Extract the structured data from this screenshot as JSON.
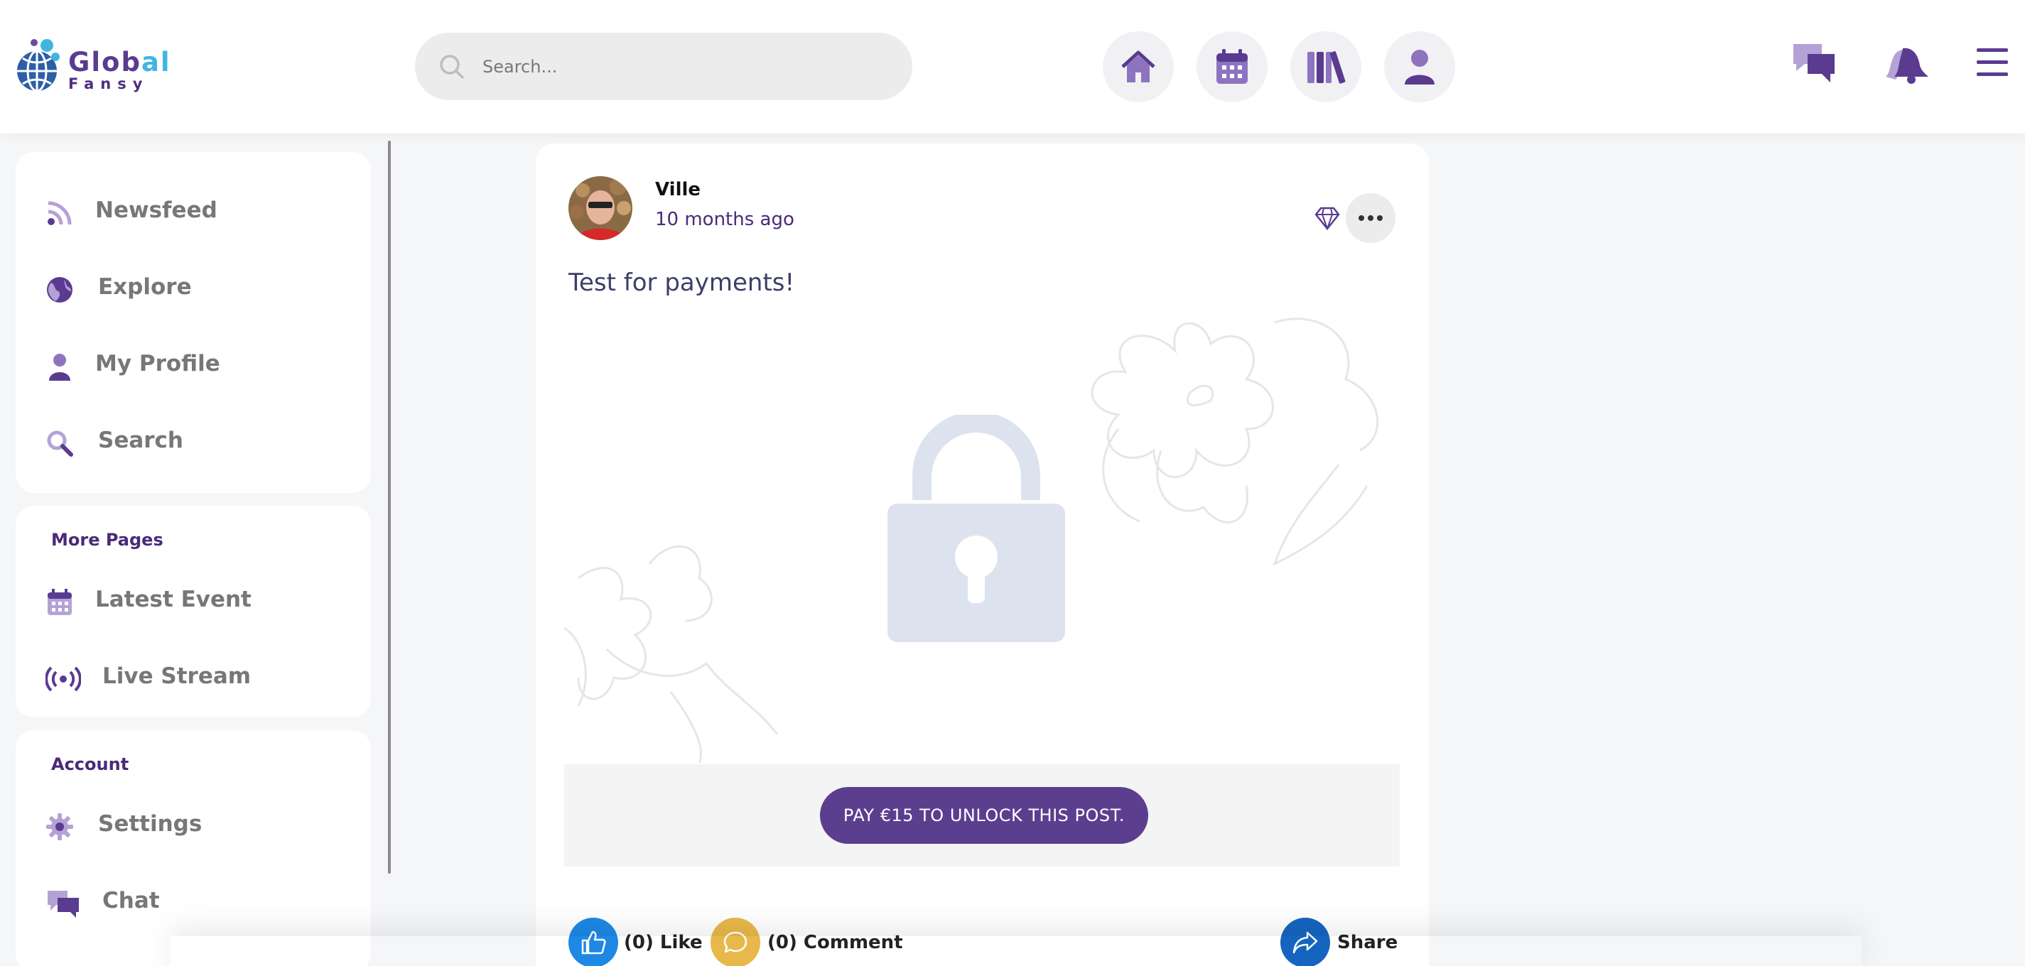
{
  "brand": {
    "line1_a": "Glob",
    "line1_b": "al",
    "line2": "Fansy"
  },
  "search": {
    "placeholder": "Search..."
  },
  "sidebar": {
    "main_items": [
      {
        "label": "Newsfeed",
        "icon": "rss-icon"
      },
      {
        "label": "Explore",
        "icon": "globe-icon"
      },
      {
        "label": "My Profile",
        "icon": "user-icon"
      },
      {
        "label": "Search",
        "icon": "search-icon"
      }
    ],
    "more_pages_title": "More Pages",
    "more_items": [
      {
        "label": "Latest Event",
        "icon": "calendar-icon"
      },
      {
        "label": "Live Stream",
        "icon": "broadcast-icon"
      }
    ],
    "account_title": "Account",
    "account_items": [
      {
        "label": "Settings",
        "icon": "gear-icon"
      },
      {
        "label": "Chat",
        "icon": "chat-icon"
      }
    ]
  },
  "post": {
    "author": "Ville",
    "time": "10 months ago",
    "text": "Test for payments!",
    "pay_button": "PAY €15 TO UNLOCK THIS POST.",
    "like_label": "(0) Like",
    "comment_label": "(0) Comment",
    "share_label": "Share"
  },
  "colors": {
    "accent": "#5c3e8f",
    "brand_purple": "#4a2a7a",
    "like_blue": "#1e88e5",
    "comment_yellow": "#e8b84a",
    "share_blue": "#1565c0"
  }
}
